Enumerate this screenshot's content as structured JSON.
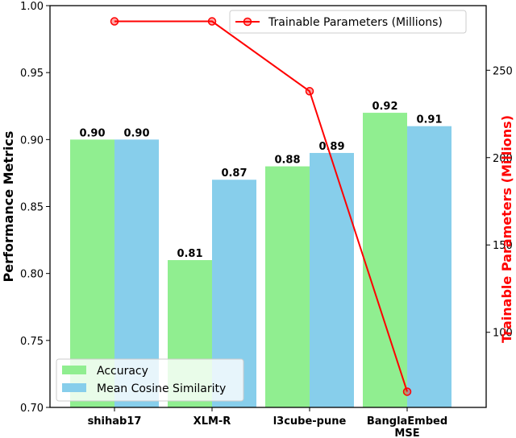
{
  "chart_data": {
    "type": "bar",
    "title": "",
    "categories": [
      "shihab17",
      "XLM-R",
      "l3cube-pune",
      "BanglaEmbed\nMSE"
    ],
    "series": [
      {
        "name": "Accuracy",
        "values": [
          0.9,
          0.81,
          0.88,
          0.92
        ],
        "color": "#90EE90",
        "labels": [
          "0.90",
          "0.81",
          "0.88",
          "0.92"
        ]
      },
      {
        "name": "Mean Cosine Similarity",
        "values": [
          0.9,
          0.87,
          0.89,
          0.91
        ],
        "color": "#87CEEB",
        "labels": [
          "0.90",
          "0.87",
          "0.89",
          "0.91"
        ]
      }
    ],
    "line_series": {
      "name": "Trainable Parameters (Millions)",
      "values": [
        278,
        278,
        238,
        66
      ],
      "color": "#FF0000",
      "marker": "circle"
    },
    "xlabel": "",
    "ylabel": "Performance Metrics",
    "ylim": [
      0.7,
      1.0
    ],
    "yticks": [
      "0.70",
      "0.75",
      "0.80",
      "0.85",
      "0.90",
      "0.95",
      "1.00"
    ],
    "ytick_values": [
      0.7,
      0.75,
      0.8,
      0.85,
      0.9,
      0.95,
      1.0
    ],
    "y2label": "Trainable Parameters (Millions)",
    "y2label_color": "#FF0000",
    "y2lim": [
      57,
      287
    ],
    "y2ticks": [
      "100",
      "150",
      "200",
      "250"
    ],
    "y2tick_values": [
      100,
      150,
      200,
      250
    ],
    "grid": false,
    "legend_bars_position": "lower-left",
    "legend_line_position": "upper-right"
  }
}
